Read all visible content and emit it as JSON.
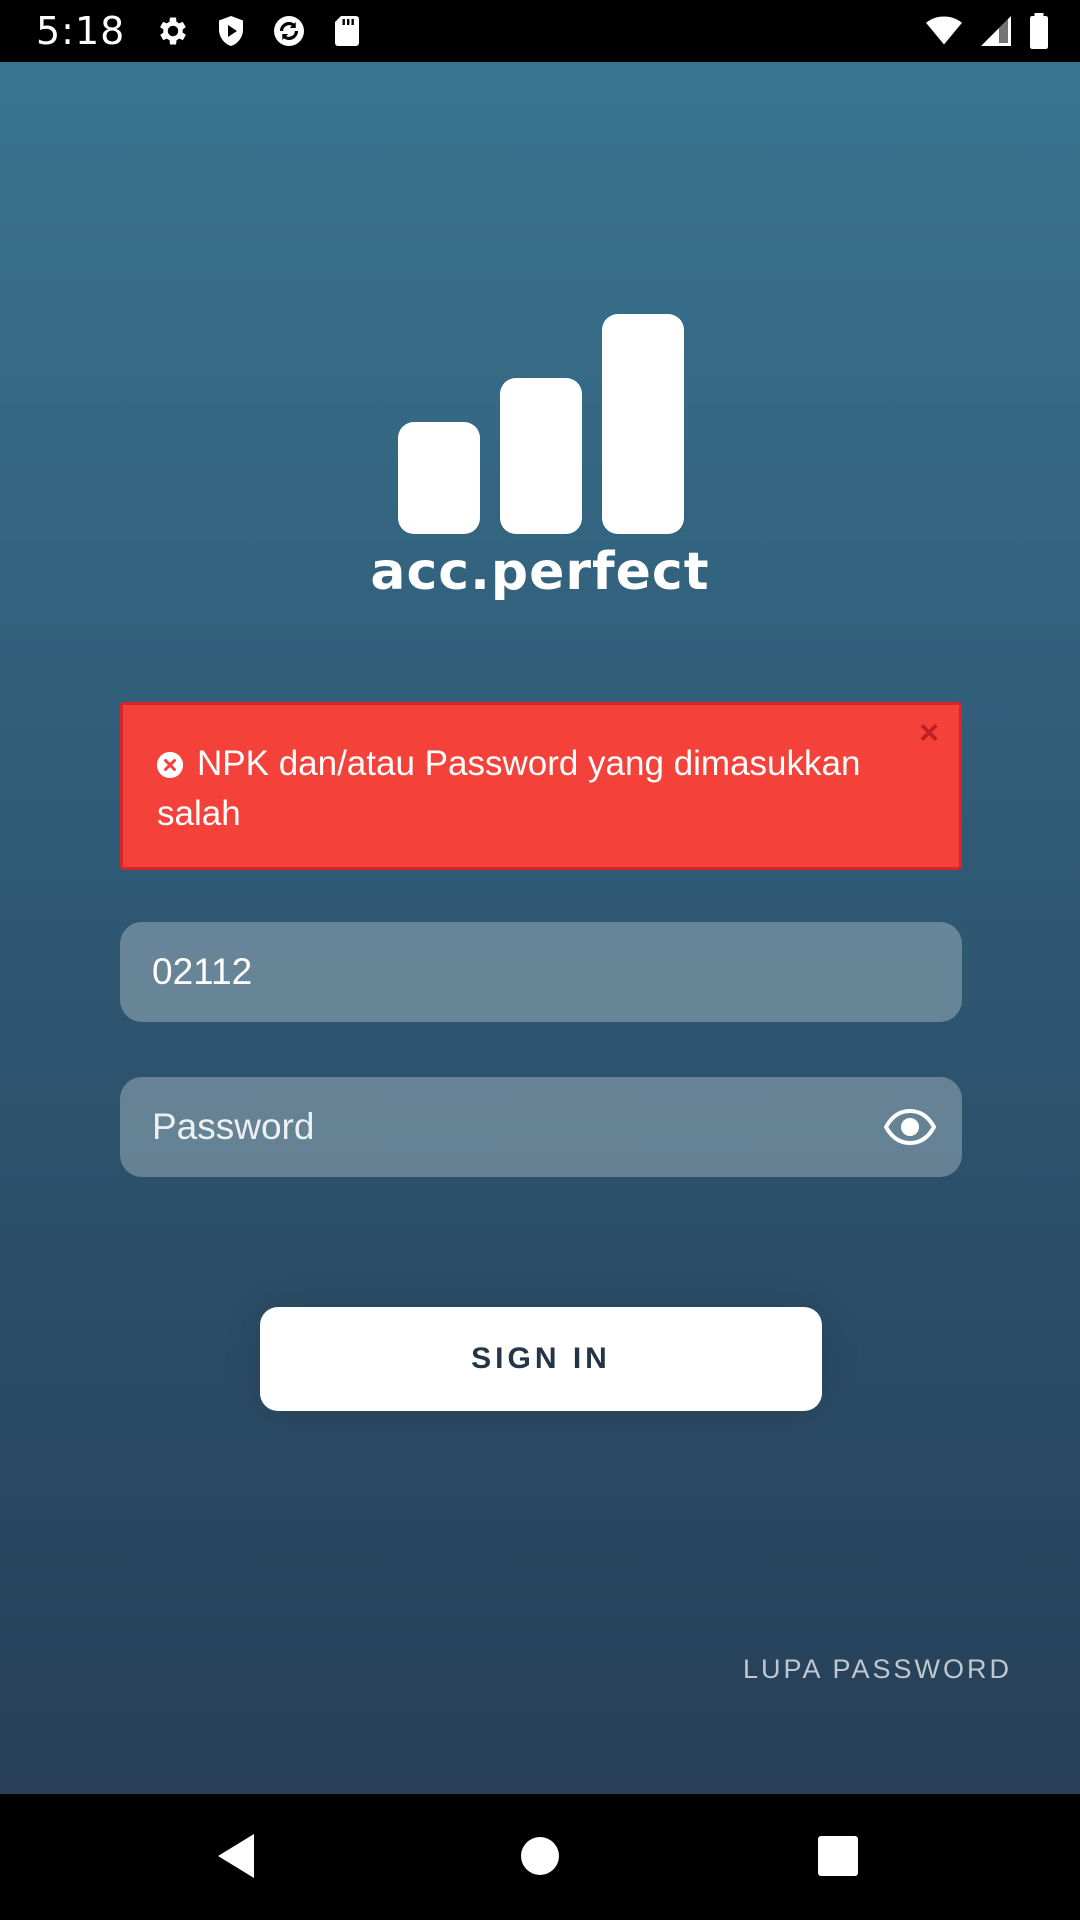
{
  "status_bar": {
    "time": "5:18",
    "left_icons": [
      "gear-icon",
      "shield-icon",
      "sync-icon",
      "sd-card-icon"
    ],
    "right_icons": [
      "wifi-icon",
      "cell-signal-icon",
      "battery-icon"
    ]
  },
  "branding": {
    "logo": "bar-chart-logo",
    "app_name": "acc.perfect"
  },
  "alert": {
    "message": "NPK dan/atau Password yang dimasukkan salah",
    "close_symbol": "×",
    "color": "#f4413a"
  },
  "login": {
    "npk_value": "02112",
    "password_placeholder": "Password",
    "signin_label": "SIGN IN",
    "forgot_label": "LUPA PASSWORD"
  },
  "nav_bar": {
    "buttons": [
      "back-icon",
      "home-icon",
      "recent-apps-icon"
    ]
  },
  "colors": {
    "background_top": "#3a7490",
    "background_bottom": "#273f58",
    "button_text": "#233547"
  }
}
